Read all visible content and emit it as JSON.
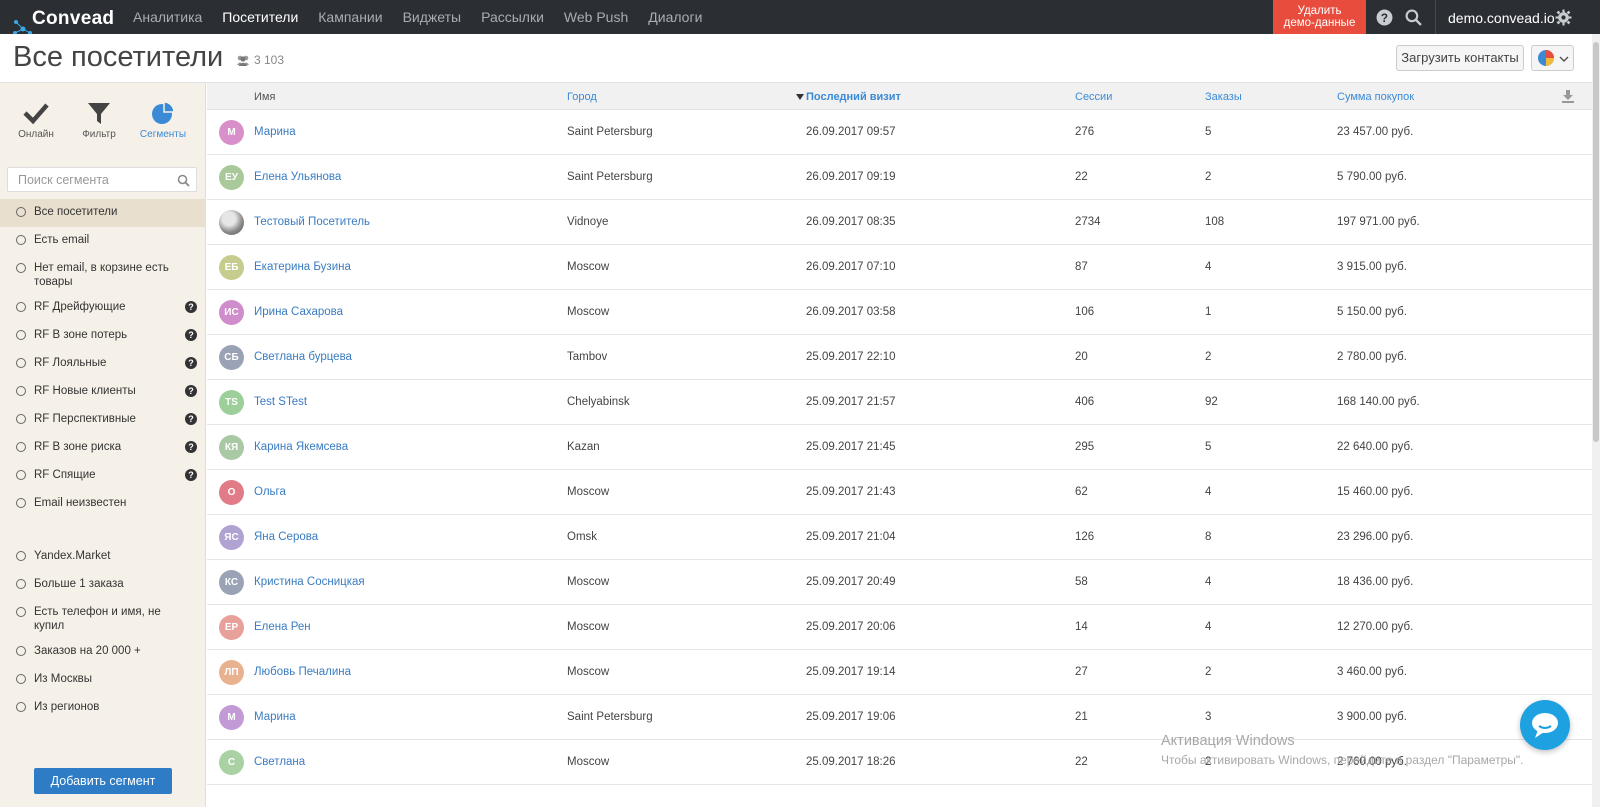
{
  "brand": {
    "name": "Convead",
    "accent": "#3a8ad6",
    "danger": "#e84c3d",
    "topbar_bg": "#2b2f33"
  },
  "nav": [
    {
      "label": "Аналитика",
      "active": false
    },
    {
      "label": "Посетители",
      "active": true
    },
    {
      "label": "Кампании",
      "active": false
    },
    {
      "label": "Виджеты",
      "active": false
    },
    {
      "label": "Рассылки",
      "active": false
    },
    {
      "label": "Web Push",
      "active": false
    },
    {
      "label": "Диалоги",
      "active": false
    }
  ],
  "topbar": {
    "demo_line1": "Удалить",
    "demo_line2": "демо-данные",
    "domain": "demo.convead.io",
    "icons": [
      "help-icon",
      "search-icon",
      "gear-icon"
    ]
  },
  "header": {
    "title": "Все посетители",
    "count": "3 103",
    "upload_label": "Загрузить контакты"
  },
  "tools": [
    {
      "label": "Онлайн",
      "icon": "checkmark-icon",
      "active": false
    },
    {
      "label": "Фильтр",
      "icon": "filter-icon",
      "active": false
    },
    {
      "label": "Сегменты",
      "icon": "pie-chart-icon",
      "active": true
    }
  ],
  "search": {
    "placeholder": "Поиск сегмента"
  },
  "segments_group1": [
    {
      "label": "Все посетители",
      "active": true,
      "help": false
    },
    {
      "label": "Есть email",
      "active": false,
      "help": false
    },
    {
      "label": "Нет email, в корзине есть товары",
      "active": false,
      "help": false
    },
    {
      "label": "RF Дрейфующие",
      "active": false,
      "help": true
    },
    {
      "label": "RF В зоне потерь",
      "active": false,
      "help": true
    },
    {
      "label": "RF Лояльные",
      "active": false,
      "help": true
    },
    {
      "label": "RF Новые клиенты",
      "active": false,
      "help": true
    },
    {
      "label": "RF Перспективные",
      "active": false,
      "help": true
    },
    {
      "label": "RF В зоне риска",
      "active": false,
      "help": true
    },
    {
      "label": "RF Спящие",
      "active": false,
      "help": true
    },
    {
      "label": "Email неизвестен",
      "active": false,
      "help": false
    }
  ],
  "segments_group2": [
    {
      "label": "Yandex.Market",
      "active": false,
      "help": false
    },
    {
      "label": "Больше 1 заказа",
      "active": false,
      "help": false
    },
    {
      "label": "Есть телефон и имя, не купил",
      "active": false,
      "help": false
    },
    {
      "label": "Заказов на 20 000 +",
      "active": false,
      "help": false
    },
    {
      "label": "Из Москвы",
      "active": false,
      "help": false
    },
    {
      "label": "Из регионов",
      "active": false,
      "help": false
    }
  ],
  "add_segment_label": "Добавить сегмент",
  "table": {
    "columns": [
      "Имя",
      "Город",
      "Последний визит",
      "Сессии",
      "Заказы",
      "Сумма покупок"
    ],
    "sorted_column": "Последний визит",
    "rows": [
      {
        "initials": "М",
        "color": "#d98fc9",
        "name": "Марина",
        "city": "Saint Petersburg",
        "visit": "26.09.2017 09:57",
        "sessions": "276",
        "orders": "5",
        "sum": "23 457.00 руб."
      },
      {
        "initials": "ЕУ",
        "color": "#a9c99a",
        "name": "Елена Ульянова",
        "city": "Saint Petersburg",
        "visit": "26.09.2017 09:19",
        "sessions": "22",
        "orders": "2",
        "sum": "5 790.00 руб."
      },
      {
        "initials": "",
        "color": "#8a8a8a",
        "name": "Тестовый Посетитель",
        "city": "Vidnoye",
        "visit": "26.09.2017 08:35",
        "sessions": "2734",
        "orders": "108",
        "sum": "197 971.00 руб.",
        "photo": true
      },
      {
        "initials": "ЕБ",
        "color": "#c5cc8e",
        "name": "Екатерина Бузина",
        "city": "Moscow",
        "visit": "26.09.2017 07:10",
        "sessions": "87",
        "orders": "4",
        "sum": "3 915.00 руб."
      },
      {
        "initials": "ИС",
        "color": "#cf8ecb",
        "name": "Ирина Сахарова",
        "city": "Moscow",
        "visit": "26.09.2017 03:58",
        "sessions": "106",
        "orders": "1",
        "sum": "5 150.00 руб."
      },
      {
        "initials": "СБ",
        "color": "#9aa3b5",
        "name": "Светлана бурцева",
        "city": "Tambov",
        "visit": "25.09.2017 22:10",
        "sessions": "20",
        "orders": "2",
        "sum": "2 780.00 руб."
      },
      {
        "initials": "TS",
        "color": "#9ccf9a",
        "name": "Test STest",
        "city": "Chelyabinsk",
        "visit": "25.09.2017 21:57",
        "sessions": "406",
        "orders": "92",
        "sum": "168 140.00 руб."
      },
      {
        "initials": "КЯ",
        "color": "#a8c9a4",
        "name": "Карина Якемсева",
        "city": "Kazan",
        "visit": "25.09.2017 21:45",
        "sessions": "295",
        "orders": "5",
        "sum": "22 640.00 руб."
      },
      {
        "initials": "О",
        "color": "#e07b87",
        "name": "Ольга",
        "city": "Moscow",
        "visit": "25.09.2017 21:43",
        "sessions": "62",
        "orders": "4",
        "sum": "15 460.00 руб."
      },
      {
        "initials": "ЯС",
        "color": "#b1a3d1",
        "name": "Яна Серова",
        "city": "Omsk",
        "visit": "25.09.2017 21:04",
        "sessions": "126",
        "orders": "8",
        "sum": "23 296.00 руб."
      },
      {
        "initials": "КС",
        "color": "#9aa3b5",
        "name": "Кристина Сосницкая",
        "city": "Moscow",
        "visit": "25.09.2017 20:49",
        "sessions": "58",
        "orders": "4",
        "sum": "18 436.00 руб."
      },
      {
        "initials": "ЕР",
        "color": "#e8a09a",
        "name": "Елена Рен",
        "city": "Moscow",
        "visit": "25.09.2017 20:06",
        "sessions": "14",
        "orders": "4",
        "sum": "12 270.00 руб."
      },
      {
        "initials": "ЛП",
        "color": "#e8b290",
        "name": "Любовь Печалина",
        "city": "Moscow",
        "visit": "25.09.2017 19:14",
        "sessions": "27",
        "orders": "2",
        "sum": "3 460.00 руб."
      },
      {
        "initials": "М",
        "color": "#c29ad6",
        "name": "Марина",
        "city": "Saint Petersburg",
        "visit": "25.09.2017 19:06",
        "sessions": "21",
        "orders": "3",
        "sum": "3 900.00 руб."
      },
      {
        "initials": "С",
        "color": "#a9d1a4",
        "name": "Светлана",
        "city": "Moscow",
        "visit": "25.09.2017 18:26",
        "sessions": "22",
        "orders": "2",
        "sum": "2 760.00 руб."
      }
    ]
  },
  "watermark": {
    "line1": "Активация Windows",
    "line2": "Чтобы активировать Windows, перейдите в раздел \"Параметры\"."
  }
}
